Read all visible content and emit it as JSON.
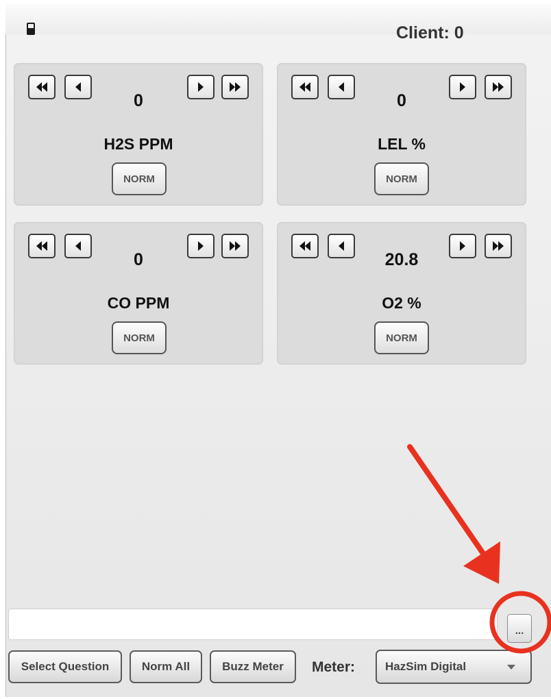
{
  "header": {
    "client_label": "Client: 0",
    "icon": "device-icon"
  },
  "sensors": [
    {
      "label": "H2S PPM",
      "value": "0",
      "norm_label": "NORM"
    },
    {
      "label": "LEL %",
      "value": "0",
      "norm_label": "NORM"
    },
    {
      "label": "CO PPM",
      "value": "0",
      "norm_label": "NORM"
    },
    {
      "label": "O2 %",
      "value": "20.8",
      "norm_label": "NORM"
    }
  ],
  "step_buttons": [
    "fast-rewind-icon",
    "step-back-icon",
    "step-forward-icon",
    "fast-forward-icon"
  ],
  "input": {
    "value": "",
    "placeholder": ""
  },
  "browse_button": {
    "label": "..."
  },
  "toolbar": {
    "select_question": "Select Question",
    "norm_all": "Norm All",
    "buzz_meter": "Buzz Meter",
    "meter_label": "Meter:",
    "meter_value": "HazSim Digital"
  },
  "annotation": {
    "color": "#e8321f"
  }
}
